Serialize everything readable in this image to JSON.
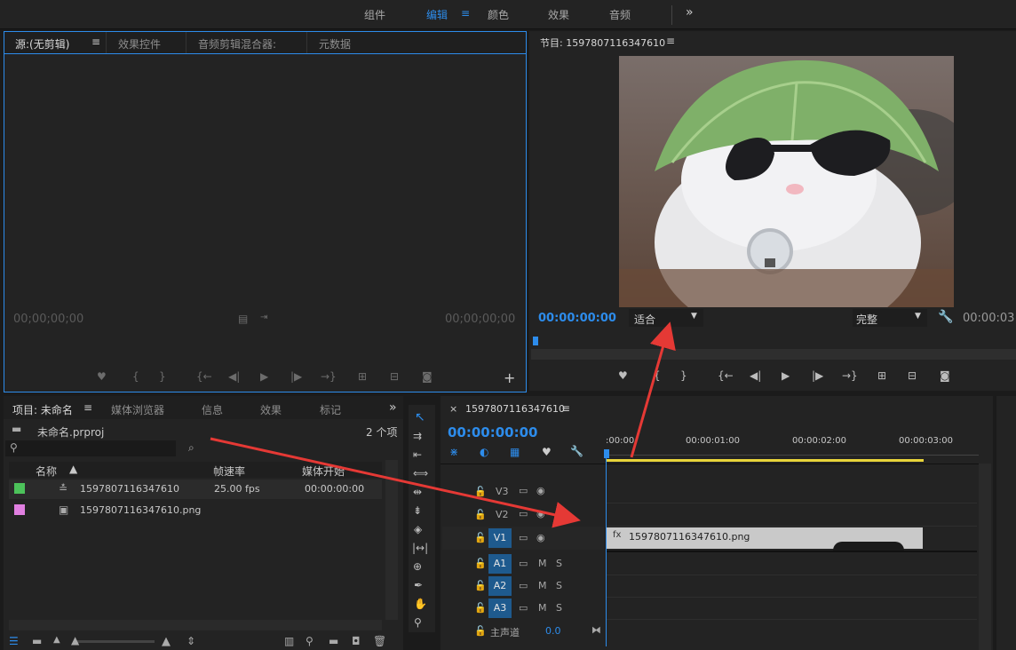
{
  "workspaces": {
    "tabs": [
      "组件",
      "编辑",
      "颜色",
      "效果",
      "音频"
    ],
    "active": "编辑",
    "more": "»"
  },
  "source_panel": {
    "tabs": [
      "源:(无剪辑)",
      "效果控件",
      "音频剪辑混合器:",
      "元数据"
    ],
    "timecode_left": "00;00;00;00",
    "timecode_right": "00;00;00;00"
  },
  "program_panel": {
    "title": "节目: 1597807116347610",
    "timecode": "00:00:00:00",
    "zoom": "适合",
    "quality": "完整",
    "timecode_right": "00:00:03"
  },
  "project_panel": {
    "tabs": [
      "项目: 未命名",
      "媒体浏览器",
      "信息",
      "效果",
      "标记"
    ],
    "project_file": "未命名.prproj",
    "item_count": "2 个项",
    "columns": [
      "名称",
      "帧速率",
      "媒体开始"
    ],
    "items": [
      {
        "name": "1597807116347610",
        "fps": "25.00 fps",
        "start": "00:00:00:00",
        "color": "#4cc25a"
      },
      {
        "name": "1597807116347610.png",
        "fps": "",
        "start": "",
        "color": "#e07fe0"
      }
    ]
  },
  "timeline": {
    "tab": "1597807116347610",
    "timecode": "00:00:00:00",
    "ruler": [
      ":00:00",
      "00:00:01:00",
      "00:00:02:00",
      "00:00:03:00"
    ],
    "video_tracks": [
      "V3",
      "V2",
      "V1"
    ],
    "audio_tracks": [
      "A1",
      "A2",
      "A3"
    ],
    "master_label": "主声道",
    "master_value": "0.0",
    "clip_name": "1597807116347610.png",
    "m_label": "M",
    "s_label": "S"
  },
  "colors": {
    "accent": "#2d8ceb",
    "arrow": "#e53935",
    "work_area": "#e8d43a"
  }
}
